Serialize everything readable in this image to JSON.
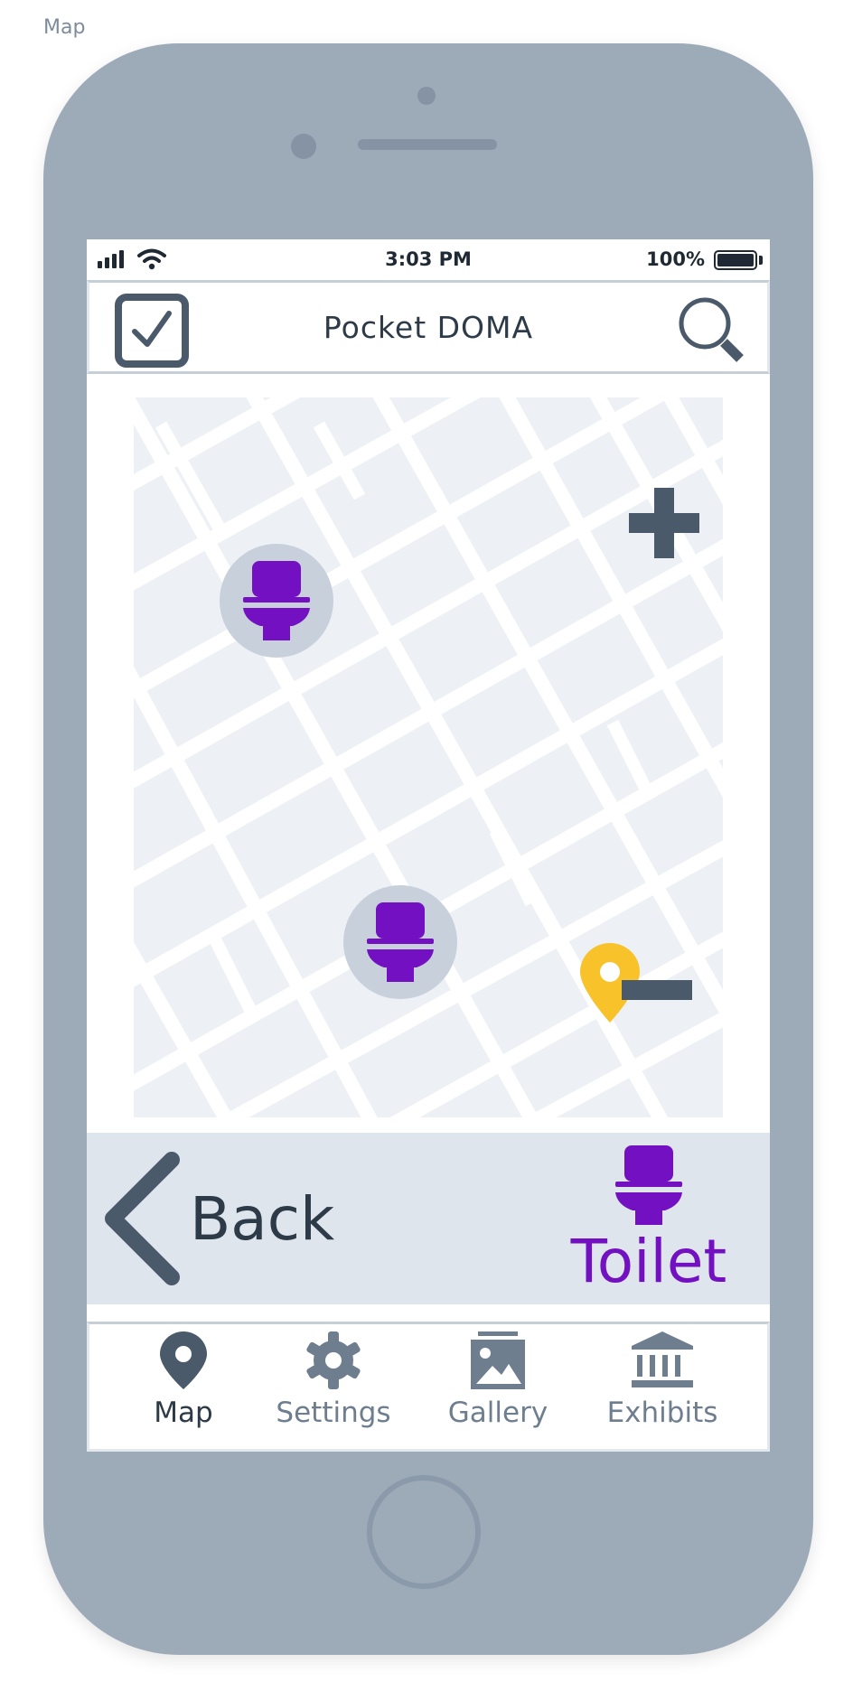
{
  "frame_label": "Map",
  "status_bar": {
    "time": "3:03 PM",
    "battery": "100%"
  },
  "header": {
    "title": "Pocket DOMA"
  },
  "action_bar": {
    "back_label": "Back",
    "category_label": "Toilet"
  },
  "tabs": [
    {
      "label": "Map",
      "icon": "map-pin-icon",
      "active": true
    },
    {
      "label": "Settings",
      "icon": "gear-icon",
      "active": false
    },
    {
      "label": "Gallery",
      "icon": "image-icon",
      "active": false
    },
    {
      "label": "Exhibits",
      "icon": "museum-icon",
      "active": false
    }
  ],
  "colors": {
    "accent": "#7311c2",
    "location_pin": "#f7c22a",
    "phone_body": "#9daab8",
    "map_bg": "#edf0f5",
    "icon_dark": "#4a5a6a"
  }
}
